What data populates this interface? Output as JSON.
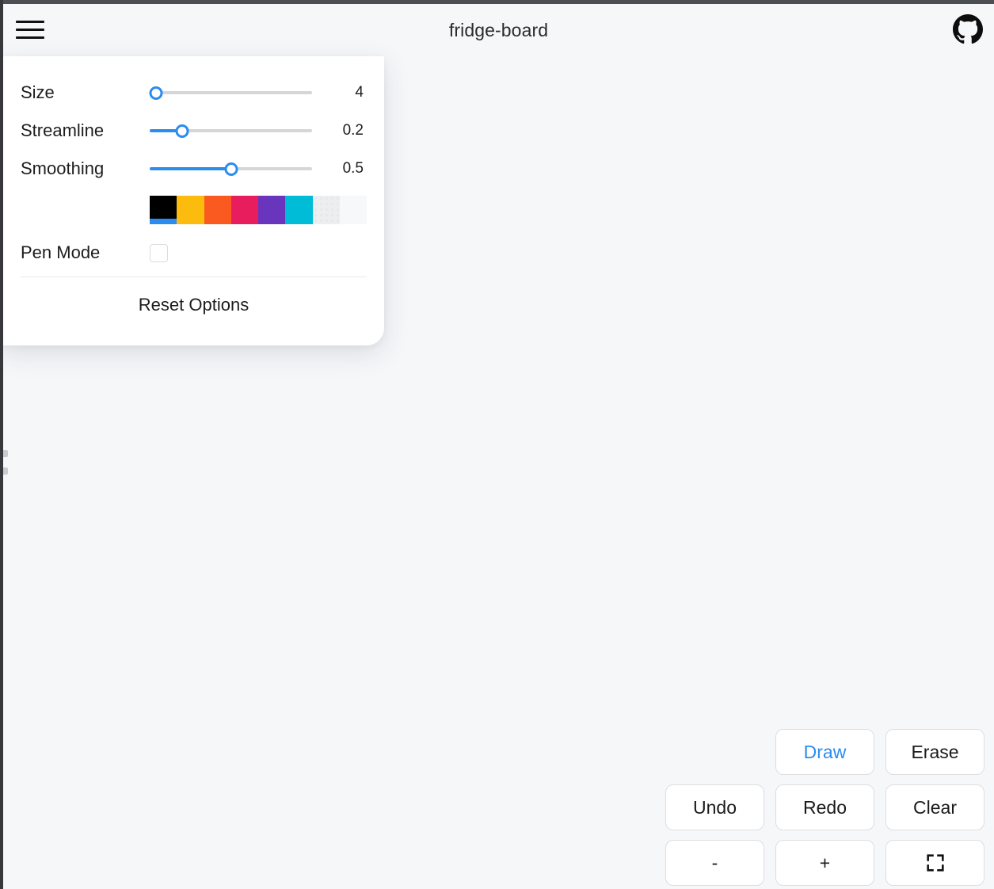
{
  "header": {
    "title": "fridge-board",
    "menu_icon": "hamburger-menu-icon",
    "github_icon": "github-icon"
  },
  "settings_panel": {
    "options": [
      {
        "label": "Size",
        "value": "4",
        "fill_percent": 4,
        "thumb_percent": 4
      },
      {
        "label": "Streamline",
        "value": "0.2",
        "fill_percent": 20,
        "thumb_percent": 20
      },
      {
        "label": "Smoothing",
        "value": "0.5",
        "fill_percent": 50,
        "thumb_percent": 50
      }
    ],
    "colors": [
      {
        "name": "black",
        "hex": "#000000",
        "selected": true,
        "checker": false
      },
      {
        "name": "amber",
        "hex": "#FCBC0D",
        "selected": false,
        "checker": false
      },
      {
        "name": "orange",
        "hex": "#FA5A20",
        "selected": false,
        "checker": false
      },
      {
        "name": "pink",
        "hex": "#E81D5E",
        "selected": false,
        "checker": false
      },
      {
        "name": "purple",
        "hex": "#6935BC",
        "selected": false,
        "checker": false
      },
      {
        "name": "cyan",
        "hex": "#00BCD6",
        "selected": false,
        "checker": false
      },
      {
        "name": "transparent",
        "hex": "#ECEEF0",
        "selected": false,
        "checker": true
      },
      {
        "name": "white",
        "hex": "#F7F8FA",
        "selected": false,
        "checker": false
      }
    ],
    "pen_mode": {
      "label": "Pen Mode",
      "checked": false
    },
    "reset_label": "Reset Options"
  },
  "toolbar": {
    "buttons": [
      {
        "name": "spacer",
        "label": "",
        "icon": null,
        "active": false,
        "empty": true
      },
      {
        "name": "draw",
        "label": "Draw",
        "icon": null,
        "active": true,
        "empty": false
      },
      {
        "name": "erase",
        "label": "Erase",
        "icon": null,
        "active": false,
        "empty": false
      },
      {
        "name": "undo",
        "label": "Undo",
        "icon": null,
        "active": false,
        "empty": false
      },
      {
        "name": "redo",
        "label": "Redo",
        "icon": null,
        "active": false,
        "empty": false
      },
      {
        "name": "clear",
        "label": "Clear",
        "icon": null,
        "active": false,
        "empty": false
      },
      {
        "name": "zoom-out",
        "label": "-",
        "icon": null,
        "active": false,
        "empty": false
      },
      {
        "name": "zoom-in",
        "label": "+",
        "icon": null,
        "active": false,
        "empty": false
      },
      {
        "name": "fullscreen",
        "label": "",
        "icon": "fullscreen-icon",
        "active": false,
        "empty": false
      }
    ]
  },
  "theme": {
    "accent": "#2B8CF0",
    "canvas_background": "#F6F7F9",
    "panel_background": "#FFFFFF",
    "text": "#1D1D1D"
  }
}
